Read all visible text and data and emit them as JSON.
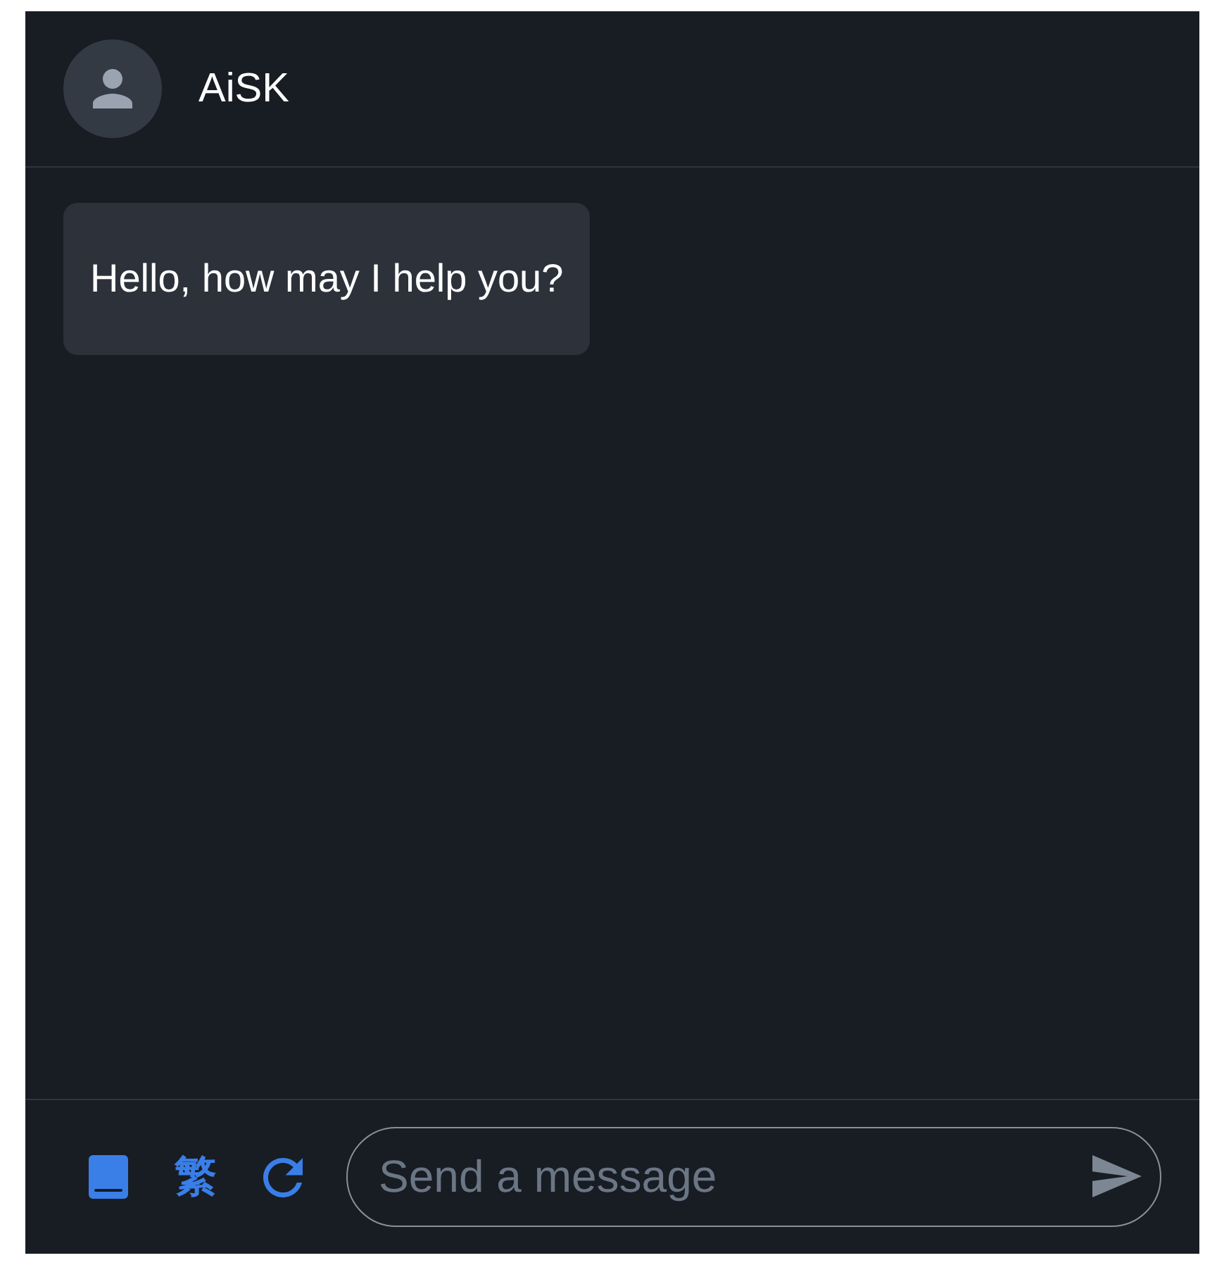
{
  "header": {
    "title": "AiSK"
  },
  "messages": [
    {
      "outgoing": false,
      "text": "Hello, how may I help you?"
    }
  ],
  "composer": {
    "language_button": "繁",
    "placeholder": "Send a message"
  }
}
